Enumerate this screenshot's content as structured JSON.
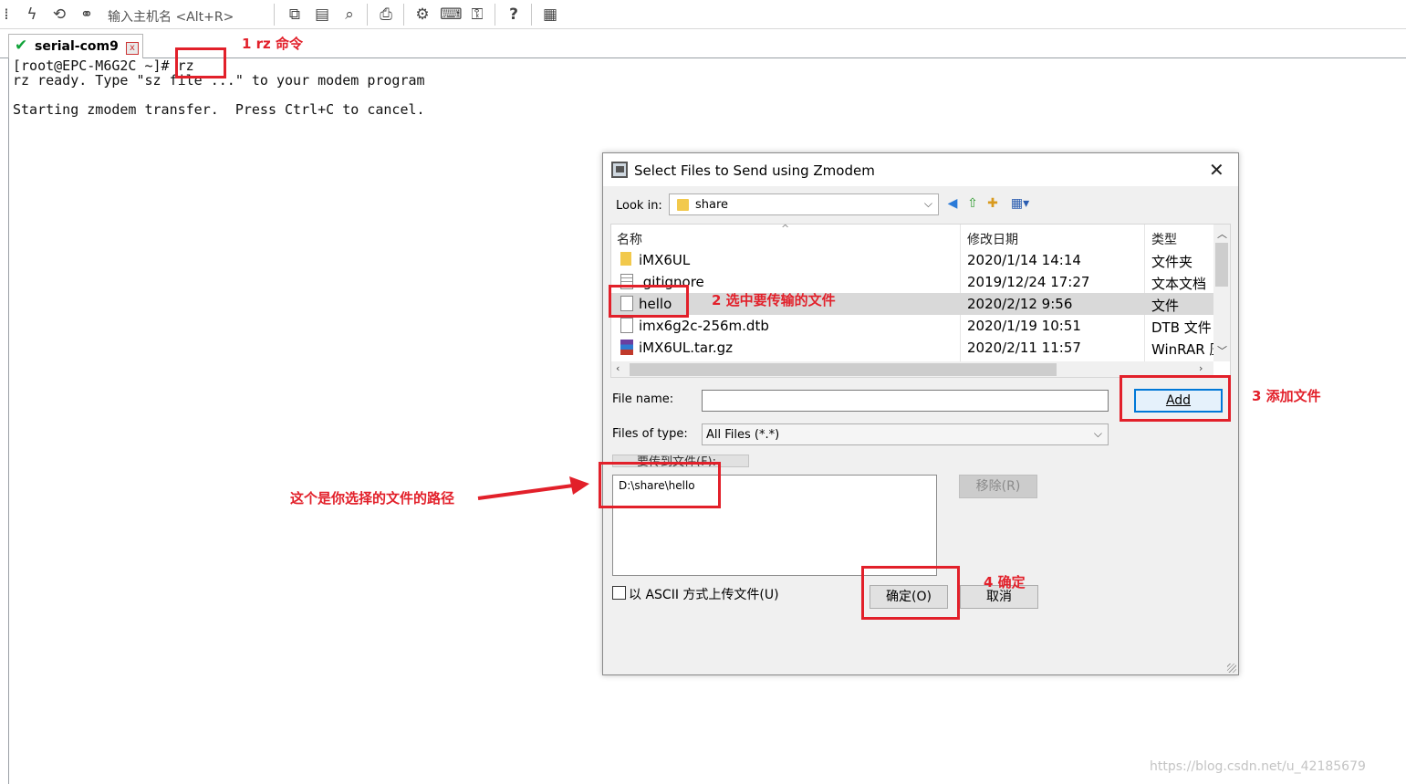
{
  "toolbar": {
    "host_placeholder": "输入主机名 <Alt+R>",
    "icons": [
      "tree-icon",
      "lightning-icon",
      "reconnect-icon",
      "link-icon",
      "copy-icon",
      "paste-icon",
      "find-icon",
      "print-icon",
      "settings-icon",
      "keyboard-icon",
      "keymap-icon",
      "help-icon",
      "map-icon"
    ]
  },
  "tab": {
    "label": "serial-com9",
    "close": "x"
  },
  "terminal": {
    "lines": [
      "[root@EPC-M6G2C ~]# rz",
      "rz ready. Type \"sz file ...\" to your modem program",
      "",
      "Starting zmodem transfer.  Press Ctrl+C to cancel."
    ]
  },
  "dialog": {
    "title": "Select Files to Send using Zmodem",
    "look_in_label": "Look in:",
    "look_in_value": "share",
    "columns": {
      "name": "名称",
      "date": "修改日期",
      "type": "类型"
    },
    "files": [
      {
        "name": "iMX6UL",
        "date": "2020/1/14 14:14",
        "type": "文件夹",
        "icon": "folder-icon"
      },
      {
        "name": ".gitignore",
        "date": "2019/12/24 17:27",
        "type": "文本文档",
        "icon": "text-file-icon"
      },
      {
        "name": "hello",
        "date": "2020/2/12 9:56",
        "type": "文件",
        "icon": "file-icon",
        "selected": true
      },
      {
        "name": "imx6g2c-256m.dtb",
        "date": "2020/1/19 10:51",
        "type": "DTB 文件",
        "icon": "file-icon"
      },
      {
        "name": "iMX6UL.tar.gz",
        "date": "2020/2/11 11:57",
        "type": "WinRAR 压",
        "icon": "archive-icon"
      }
    ],
    "file_name_label": "File name:",
    "file_name_value": "",
    "add_button": "Add",
    "file_type_label": "Files of type:",
    "file_type_value": "All Files (*.*)",
    "send_list_label": "要传到文件(F):",
    "send_list_items": [
      "D:\\share\\hello"
    ],
    "remove_button": "移除(R)",
    "ascii_label": "以 ASCII 方式上传文件(U)",
    "ok_button": "确定(O)",
    "cancel_button": "取消"
  },
  "annotations": {
    "step1": "1 rz 命令",
    "step2": "2 选中要传输的文件",
    "step3": "3 添加文件",
    "step4": "4 确定",
    "path_note": "这个是你选择的文件的路径"
  },
  "watermark": "https://blog.csdn.net/u_42185679",
  "colors": {
    "annotation_red": "#e2202a",
    "selection_gray": "#d9d9d9",
    "default_button_blue": "#0078d7"
  }
}
